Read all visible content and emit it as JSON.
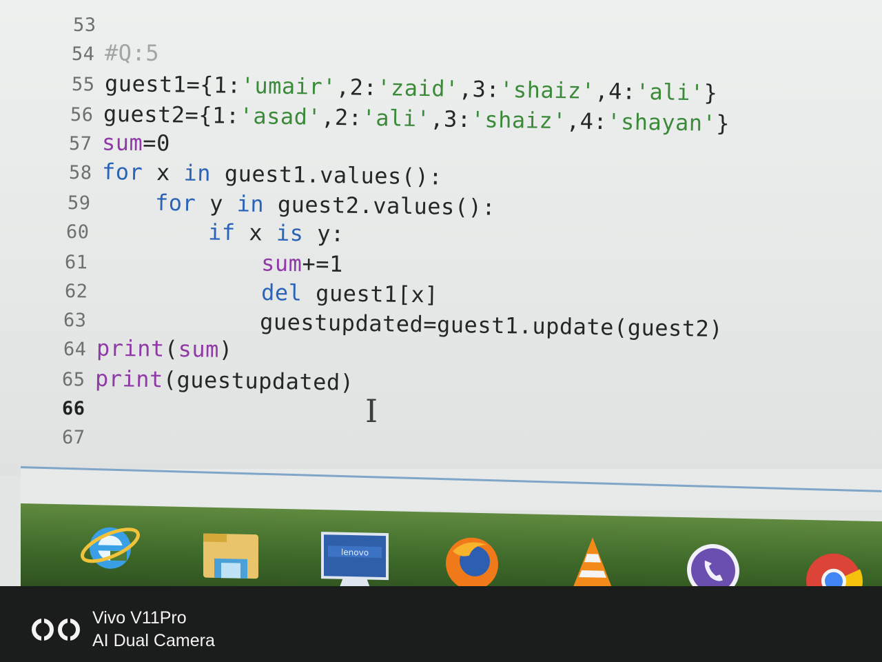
{
  "editor": {
    "lines": [
      {
        "no": "53",
        "cur": false,
        "tokens": []
      },
      {
        "no": "54",
        "cur": false,
        "tokens": [
          {
            "t": "#Q:5",
            "c": "cm"
          }
        ]
      },
      {
        "no": "55",
        "cur": false,
        "tokens": [
          {
            "t": "guest1={1:",
            "c": "plain"
          },
          {
            "t": "'umair'",
            "c": "str"
          },
          {
            "t": ",2:",
            "c": "plain"
          },
          {
            "t": "'zaid'",
            "c": "str"
          },
          {
            "t": ",3:",
            "c": "plain"
          },
          {
            "t": "'shaiz'",
            "c": "str"
          },
          {
            "t": ",4:",
            "c": "plain"
          },
          {
            "t": "'ali'",
            "c": "str"
          },
          {
            "t": "}",
            "c": "plain"
          }
        ]
      },
      {
        "no": "56",
        "cur": false,
        "tokens": [
          {
            "t": "guest2={1:",
            "c": "plain"
          },
          {
            "t": "'asad'",
            "c": "str"
          },
          {
            "t": ",2:",
            "c": "plain"
          },
          {
            "t": "'ali'",
            "c": "str"
          },
          {
            "t": ",3:",
            "c": "plain"
          },
          {
            "t": "'shaiz'",
            "c": "str"
          },
          {
            "t": ",4:",
            "c": "plain"
          },
          {
            "t": "'shayan'",
            "c": "str"
          },
          {
            "t": "}",
            "c": "plain"
          }
        ]
      },
      {
        "no": "57",
        "cur": false,
        "tokens": [
          {
            "t": "sum",
            "c": "bi"
          },
          {
            "t": "=0",
            "c": "plain"
          }
        ]
      },
      {
        "no": "58",
        "cur": false,
        "tokens": [
          {
            "t": "for",
            "c": "kw"
          },
          {
            "t": " x ",
            "c": "plain"
          },
          {
            "t": "in",
            "c": "kw"
          },
          {
            "t": " guest1.values():",
            "c": "plain"
          }
        ]
      },
      {
        "no": "59",
        "cur": false,
        "tokens": [
          {
            "t": "    ",
            "c": "plain"
          },
          {
            "t": "for",
            "c": "kw"
          },
          {
            "t": " y ",
            "c": "plain"
          },
          {
            "t": "in",
            "c": "kw"
          },
          {
            "t": " guest2.values():",
            "c": "plain"
          }
        ]
      },
      {
        "no": "60",
        "cur": false,
        "tokens": [
          {
            "t": "        ",
            "c": "plain"
          },
          {
            "t": "if",
            "c": "kw"
          },
          {
            "t": " x ",
            "c": "plain"
          },
          {
            "t": "is",
            "c": "kw"
          },
          {
            "t": " y:",
            "c": "plain"
          }
        ]
      },
      {
        "no": "61",
        "cur": false,
        "tokens": [
          {
            "t": "            ",
            "c": "plain"
          },
          {
            "t": "sum",
            "c": "bi"
          },
          {
            "t": "+=1",
            "c": "plain"
          }
        ]
      },
      {
        "no": "62",
        "cur": false,
        "tokens": [
          {
            "t": "            ",
            "c": "plain"
          },
          {
            "t": "del",
            "c": "kw"
          },
          {
            "t": " guest1[x]",
            "c": "plain"
          }
        ]
      },
      {
        "no": "63",
        "cur": false,
        "tokens": [
          {
            "t": "            guestupdated=guest1.update(guest2)",
            "c": "plain"
          }
        ]
      },
      {
        "no": "64",
        "cur": false,
        "tokens": [
          {
            "t": "print",
            "c": "bi"
          },
          {
            "t": "(",
            "c": "plain"
          },
          {
            "t": "sum",
            "c": "bi"
          },
          {
            "t": ")",
            "c": "plain"
          }
        ]
      },
      {
        "no": "65",
        "cur": false,
        "tokens": [
          {
            "t": "print",
            "c": "bi"
          },
          {
            "t": "(guestupdated)",
            "c": "plain"
          }
        ]
      },
      {
        "no": "66",
        "cur": true,
        "tokens": []
      },
      {
        "no": "67",
        "cur": false,
        "tokens": []
      }
    ],
    "cursor_glyph": "I"
  },
  "taskbar": {
    "items": [
      {
        "name": "internet-explorer-icon"
      },
      {
        "name": "file-explorer-icon"
      },
      {
        "name": "lenovo-icon",
        "label": "lenovo"
      },
      {
        "name": "firefox-icon"
      },
      {
        "name": "vlc-icon"
      },
      {
        "name": "viber-icon"
      },
      {
        "name": "chrome-icon"
      }
    ]
  },
  "watermark": {
    "line1": "Vivo V11Pro",
    "line2": "AI Dual Camera"
  },
  "colors": {
    "keyword": "#2b63b8",
    "builtin": "#8f3aa6",
    "string": "#3b8a3a",
    "taskbar": "#4f7a35"
  }
}
